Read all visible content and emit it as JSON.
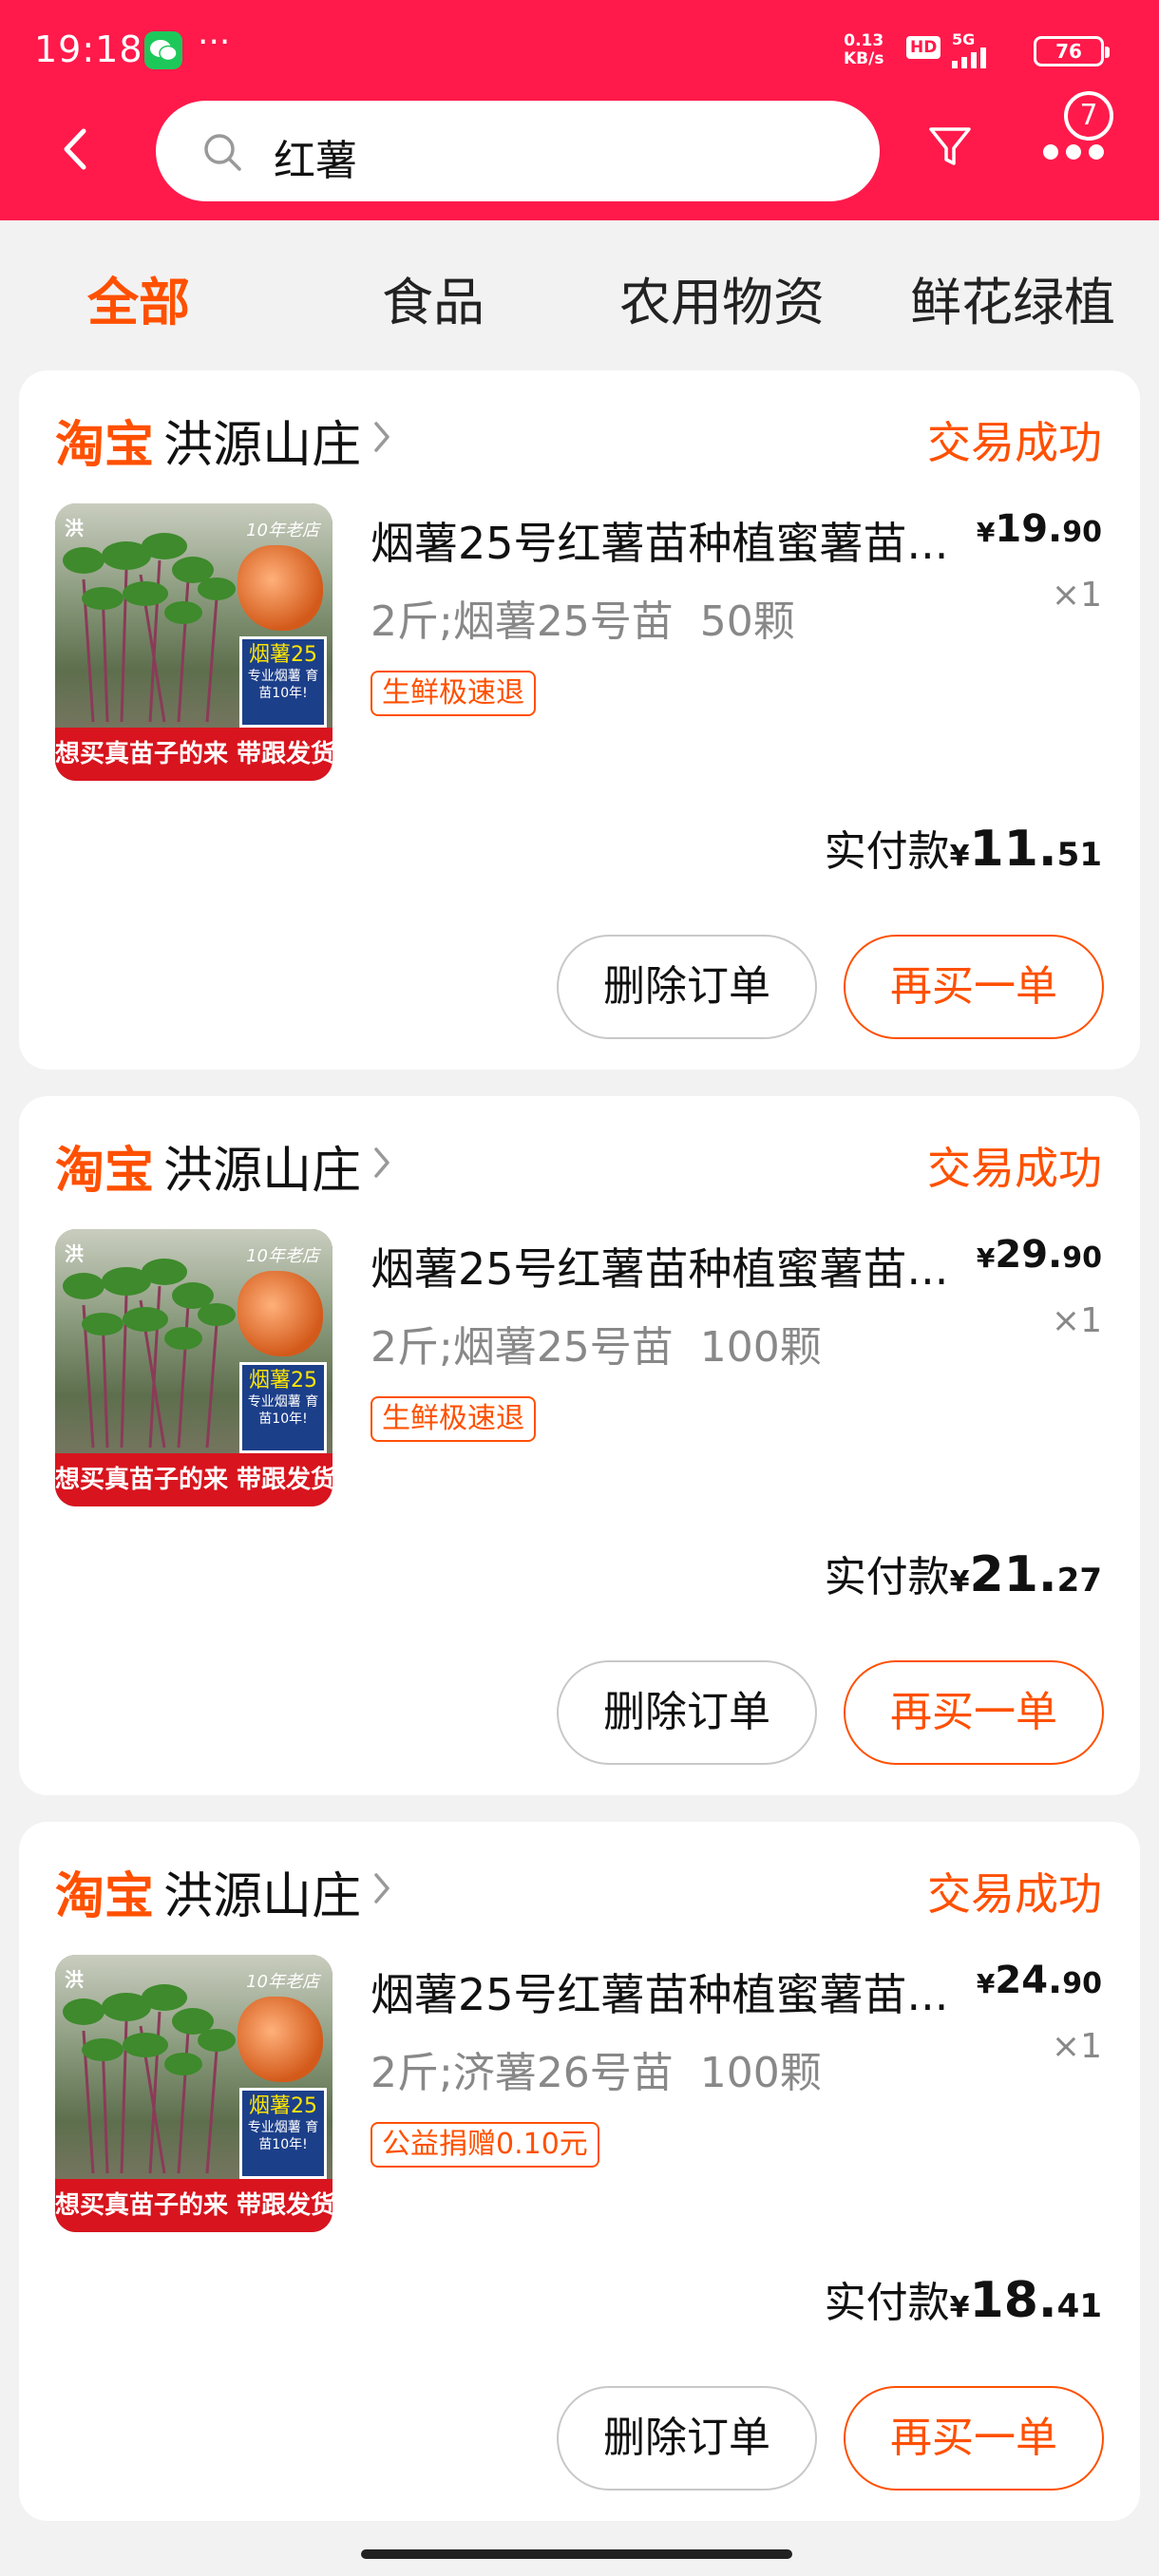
{
  "status_bar": {
    "time": "19:18",
    "more": "···",
    "net_speed_value": "0.13",
    "net_speed_unit": "KB/s",
    "hd": "HD",
    "network": "5G",
    "battery": "76"
  },
  "header": {
    "search_text": "红薯",
    "badge_count": "7"
  },
  "tabs": [
    {
      "label": "全部",
      "active": true
    },
    {
      "label": "食品",
      "active": false
    },
    {
      "label": "农用物资",
      "active": false
    },
    {
      "label": "鲜花绿植",
      "active": false
    }
  ],
  "orders": [
    {
      "brand": "淘宝",
      "shop": "洪源山庄",
      "status": "交易成功",
      "title": "烟薯25号红薯苗种植蜜薯苗...",
      "price_yen": "¥",
      "price_int": "19.",
      "price_dec": "90",
      "qty": "×1",
      "spec": "2斤;烟薯25号苗  50颗",
      "promo": "生鲜极速退",
      "paid_label": "实付款",
      "paid_yen": "¥",
      "paid_int": "11.",
      "paid_dec": "51",
      "delete_label": "删除订单",
      "rebuy_label": "再买一单",
      "thumb": {
        "corner": "洪",
        "corner_r": "10年老店",
        "tag": "烟薯25",
        "tag_small": "专业烟薯 育苗10年!",
        "banner": "想买真苗子的来  带跟发货"
      }
    },
    {
      "brand": "淘宝",
      "shop": "洪源山庄",
      "status": "交易成功",
      "title": "烟薯25号红薯苗种植蜜薯苗...",
      "price_yen": "¥",
      "price_int": "29.",
      "price_dec": "90",
      "qty": "×1",
      "spec": "2斤;烟薯25号苗  100颗",
      "promo": "生鲜极速退",
      "paid_label": "实付款",
      "paid_yen": "¥",
      "paid_int": "21.",
      "paid_dec": "27",
      "delete_label": "删除订单",
      "rebuy_label": "再买一单",
      "thumb": {
        "corner": "洪",
        "corner_r": "10年老店",
        "tag": "烟薯25",
        "tag_small": "专业烟薯 育苗10年!",
        "banner": "想买真苗子的来  带跟发货"
      }
    },
    {
      "brand": "淘宝",
      "shop": "洪源山庄",
      "status": "交易成功",
      "title": "烟薯25号红薯苗种植蜜薯苗...",
      "price_yen": "¥",
      "price_int": "24.",
      "price_dec": "90",
      "qty": "×1",
      "spec": "2斤;济薯26号苗  100颗",
      "promo": "公益捐赠0.10元",
      "paid_label": "实付款",
      "paid_yen": "¥",
      "paid_int": "18.",
      "paid_dec": "41",
      "delete_label": "删除订单",
      "rebuy_label": "再买一单",
      "thumb": {
        "corner": "洪",
        "corner_r": "10年老店",
        "tag": "烟薯25",
        "tag_small": "专业烟薯 育苗10年!",
        "banner": "想买真苗子的来  带跟发货"
      }
    }
  ],
  "colors": {
    "header_red": "#ff1a4b",
    "accent_orange": "#ff5000",
    "page_bg": "#f2f2f2"
  }
}
